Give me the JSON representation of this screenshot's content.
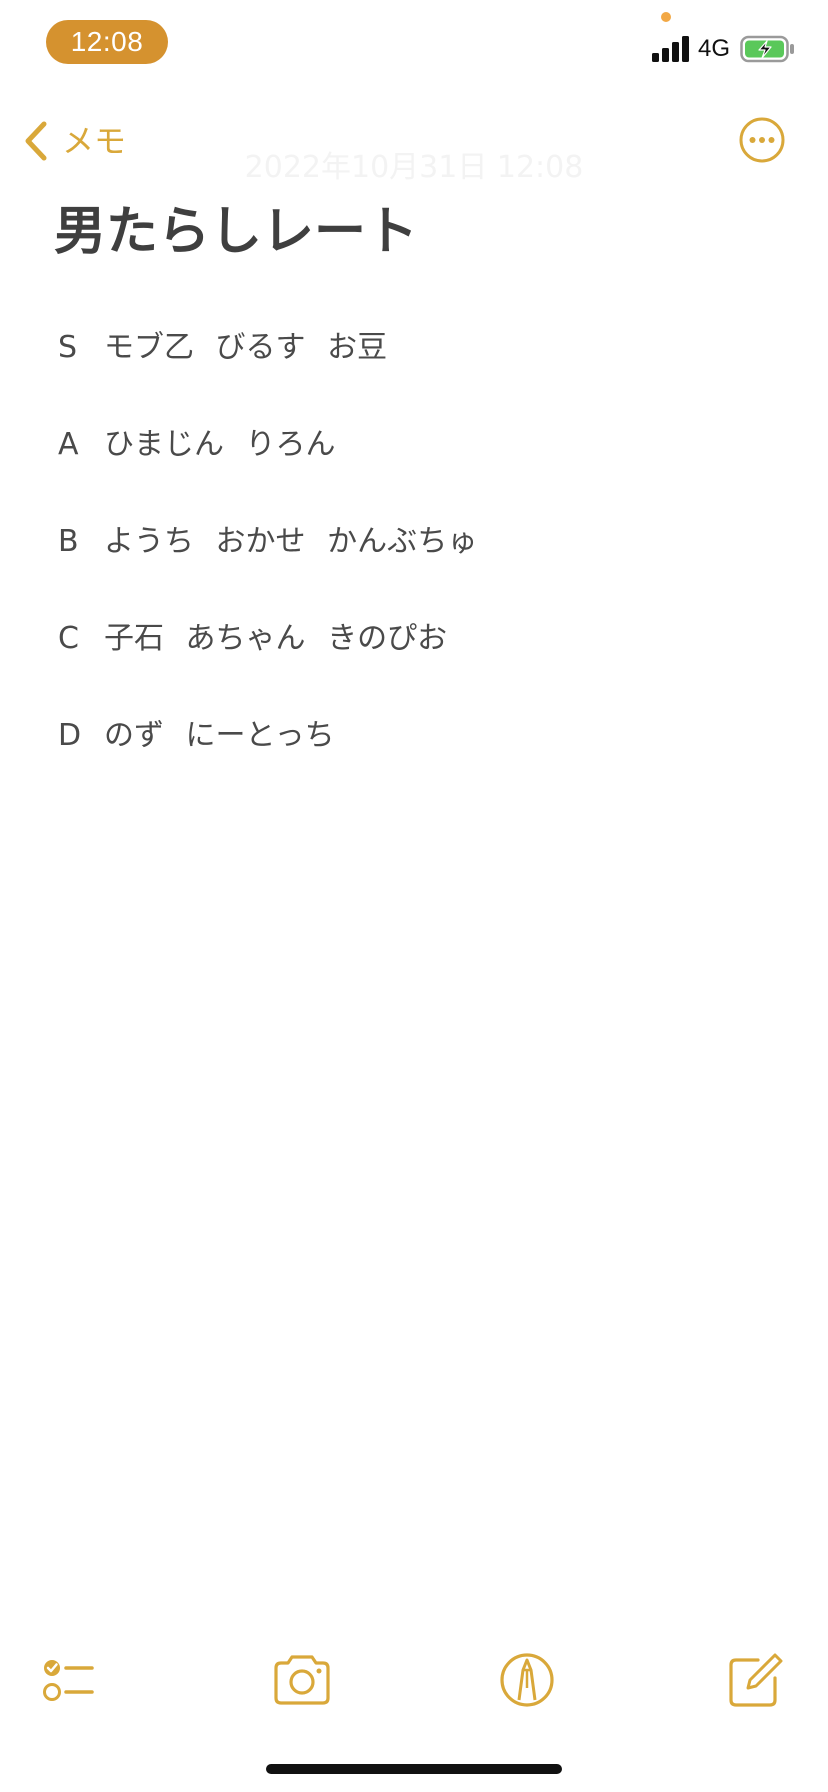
{
  "status_bar": {
    "time": "12:08",
    "network": "4G",
    "icons": [
      "signal-icon",
      "battery-charging-icon"
    ],
    "time_pill_color": "#d5922f"
  },
  "nav": {
    "back_label": "メモ",
    "back_icon": "chevron-left-icon",
    "more_icon": "ellipsis-circle-icon",
    "date": "2022年10月31日 12:08",
    "accent_color": "#d9a83a"
  },
  "note": {
    "title": "男たらしレート",
    "lines": [
      {
        "rank": "S",
        "names": "モブ乙 びるす お豆"
      },
      {
        "rank": "A",
        "names": "ひまじん りろん"
      },
      {
        "rank": "B",
        "names": "ようち おかせ かんぶちゅ"
      },
      {
        "rank": "C",
        "names": "子石 あちゃん きのぴお"
      },
      {
        "rank": "D",
        "names": "のず にーとっち"
      }
    ]
  },
  "toolbar": {
    "icons": [
      "checklist-icon",
      "camera-icon",
      "markup-pen-icon",
      "compose-icon"
    ]
  }
}
